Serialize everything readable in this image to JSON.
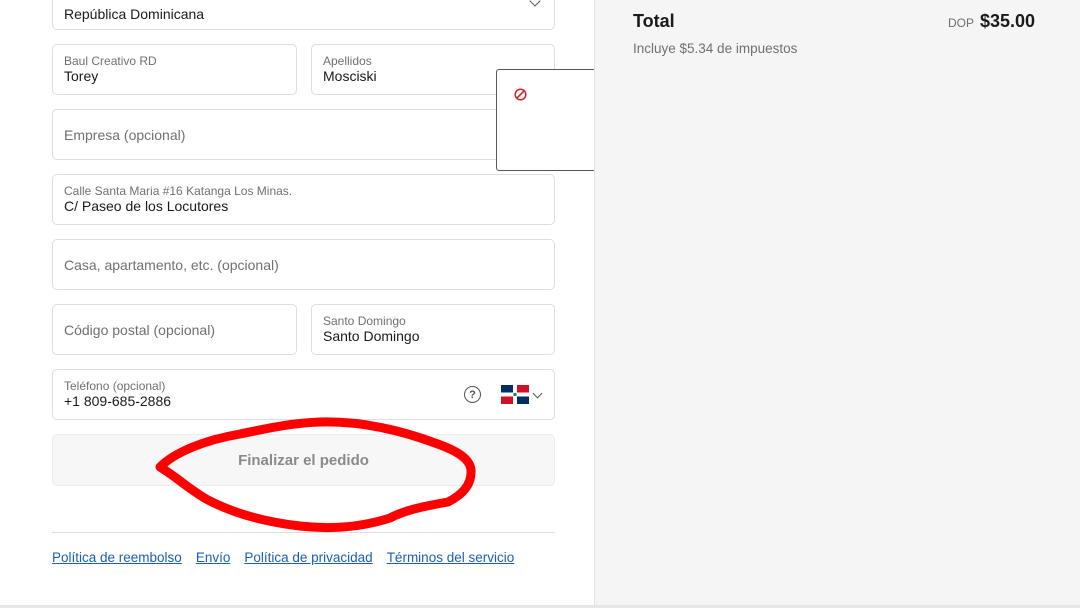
{
  "form": {
    "country": {
      "value": "República Dominicana"
    },
    "first_name": {
      "label": "Baul Creativo RD",
      "value": "Torey"
    },
    "last_name": {
      "label": "Apellidos",
      "value": "Mosciski"
    },
    "company": {
      "placeholder": "Empresa (opcional)"
    },
    "address": {
      "label": "Calle Santa Maria #16 Katanga Los Minas.",
      "value": "C/ Paseo de los Locutores"
    },
    "apartment": {
      "placeholder": "Casa, apartamento, etc. (opcional)"
    },
    "postal_code": {
      "placeholder": "Código postal (opcional)"
    },
    "city": {
      "label": "Santo Domingo",
      "value": "Santo Domingo"
    },
    "phone": {
      "label": "Teléfono (opcional)",
      "value": "+1 809-685-2886",
      "help": "?"
    },
    "submit_label": "Finalizar el pedido"
  },
  "footer_links": [
    "Política de reembolso",
    "Envío",
    "Política de privacidad",
    "Términos del servicio"
  ],
  "summary": {
    "total_label": "Total",
    "currency": "DOP",
    "amount": "$35.00",
    "tax_note": "Incluye $5.34 de impuestos"
  },
  "colors": {
    "link": "#1a5fb4",
    "annotation": "#ff0000",
    "blocked": "#cc2222",
    "flag_blue": "#002d62",
    "flag_red": "#ce1126"
  },
  "icons": {
    "country_dropdown": "chevron-down-icon",
    "phone_help": "question-circle-icon",
    "phone_country": "dominican-republic-flag-icon",
    "popup": "blocked-icon"
  }
}
